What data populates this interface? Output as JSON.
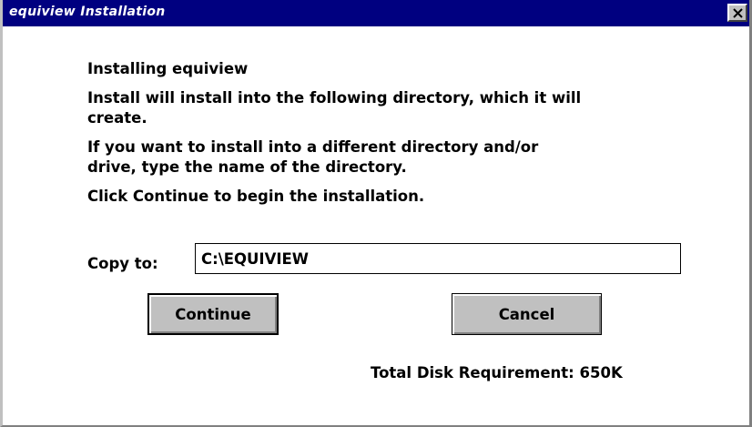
{
  "window": {
    "title": "equiview Installation",
    "close_symbol": "×"
  },
  "content": {
    "heading": "Installing equiview",
    "paragraph1_line1": "Install will install into the following directory, which it will",
    "paragraph1_line2": "create.",
    "paragraph2_line1": "If you want to install into a different directory and/or",
    "paragraph2_line2": "drive, type the name of the directory.",
    "paragraph3": "Click Continue to begin the installation.",
    "copy_to_label": "Copy to:",
    "copy_to_value": "C:\\EQUIVIEW",
    "continue_label": "Continue",
    "cancel_label": "Cancel",
    "total_disk_label": "Total Disk Requirement: 650K"
  },
  "colors": {
    "titlebar_bg": "#000080",
    "titlebar_text": "#ffffff",
    "button_face": "#c0c0c0",
    "window_bg": "#ffffff"
  },
  "icons": {
    "close": "close-icon"
  }
}
